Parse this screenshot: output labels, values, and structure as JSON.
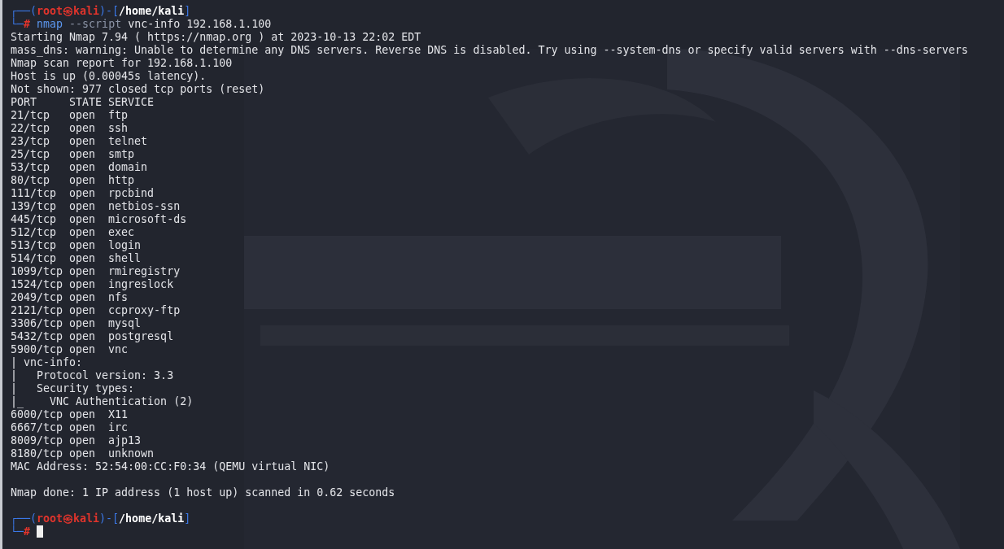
{
  "prompts": [
    {
      "frame_top": "┌──(",
      "user_host": "root㉿kali",
      "bracket_open": ")-[",
      "path": "/home/kali",
      "bracket_close": "]",
      "frame_bottom": "└─",
      "symbol": "#",
      "command": [
        {
          "kind": "program",
          "text": "nmap"
        },
        {
          "kind": "option",
          "text": "--script"
        },
        {
          "kind": "arg",
          "text": "vnc-info 192.168.1.100"
        }
      ],
      "output": [
        {
          "kind": "text",
          "text": "Starting Nmap 7.94 ( https://nmap.org ) at 2023-10-13 22:02 EDT"
        },
        {
          "kind": "text",
          "text": "mass_dns: warning: Unable to determine any DNS servers. Reverse DNS is disabled. Try using --system-dns or specify valid servers with --dns-servers"
        },
        {
          "kind": "text",
          "text": "Nmap scan report for 192.168.1.100"
        },
        {
          "kind": "text",
          "text": "Host is up (0.00045s latency)."
        },
        {
          "kind": "text",
          "text": "Not shown: 977 closed tcp ports (reset)"
        },
        {
          "kind": "text",
          "text": "PORT     STATE SERVICE"
        },
        {
          "kind": "text",
          "text": "21/tcp   open  ftp"
        },
        {
          "kind": "text",
          "text": "22/tcp   open  ssh"
        },
        {
          "kind": "text",
          "text": "23/tcp   open  telnet"
        },
        {
          "kind": "text",
          "text": "25/tcp   open  smtp"
        },
        {
          "kind": "text",
          "text": "53/tcp   open  domain"
        },
        {
          "kind": "text",
          "text": "80/tcp   open  http"
        },
        {
          "kind": "text",
          "text": "111/tcp  open  rpcbind"
        },
        {
          "kind": "text",
          "text": "139/tcp  open  netbios-ssn"
        },
        {
          "kind": "text",
          "text": "445/tcp  open  microsoft-ds"
        },
        {
          "kind": "text",
          "text": "512/tcp  open  exec"
        },
        {
          "kind": "text",
          "text": "513/tcp  open  login"
        },
        {
          "kind": "text",
          "text": "514/tcp  open  shell"
        },
        {
          "kind": "text",
          "text": "1099/tcp open  rmiregistry"
        },
        {
          "kind": "text",
          "text": "1524/tcp open  ingreslock"
        },
        {
          "kind": "text",
          "text": "2049/tcp open  nfs"
        },
        {
          "kind": "text",
          "text": "2121/tcp open  ccproxy-ftp"
        },
        {
          "kind": "text",
          "text": "3306/tcp open  mysql"
        },
        {
          "kind": "text",
          "text": "5432/tcp open  postgresql"
        },
        {
          "kind": "text",
          "text": "5900/tcp open  vnc"
        },
        {
          "kind": "text",
          "text": "| vnc-info:"
        },
        {
          "kind": "text",
          "text": "|   Protocol version: 3.3"
        },
        {
          "kind": "text",
          "text": "|   Security types:"
        },
        {
          "kind": "text",
          "text": "|_    VNC Authentication (2)"
        },
        {
          "kind": "text",
          "text": "6000/tcp open  X11"
        },
        {
          "kind": "text",
          "text": "6667/tcp open  irc"
        },
        {
          "kind": "text",
          "text": "8009/tcp open  ajp13"
        },
        {
          "kind": "text",
          "text": "8180/tcp open  unknown"
        },
        {
          "kind": "text",
          "text": "MAC Address: 52:54:00:CC:F0:34 (QEMU virtual NIC)"
        },
        {
          "kind": "blank"
        },
        {
          "kind": "text",
          "text": "Nmap done: 1 IP address (1 host up) scanned in 0.62 seconds"
        },
        {
          "kind": "blank"
        }
      ]
    },
    {
      "frame_top": "┌──(",
      "user_host": "root㉿kali",
      "bracket_open": ")-[",
      "path": "/home/kali",
      "bracket_close": "]",
      "frame_bottom": "└─",
      "symbol": "#",
      "cursor": true
    }
  ]
}
